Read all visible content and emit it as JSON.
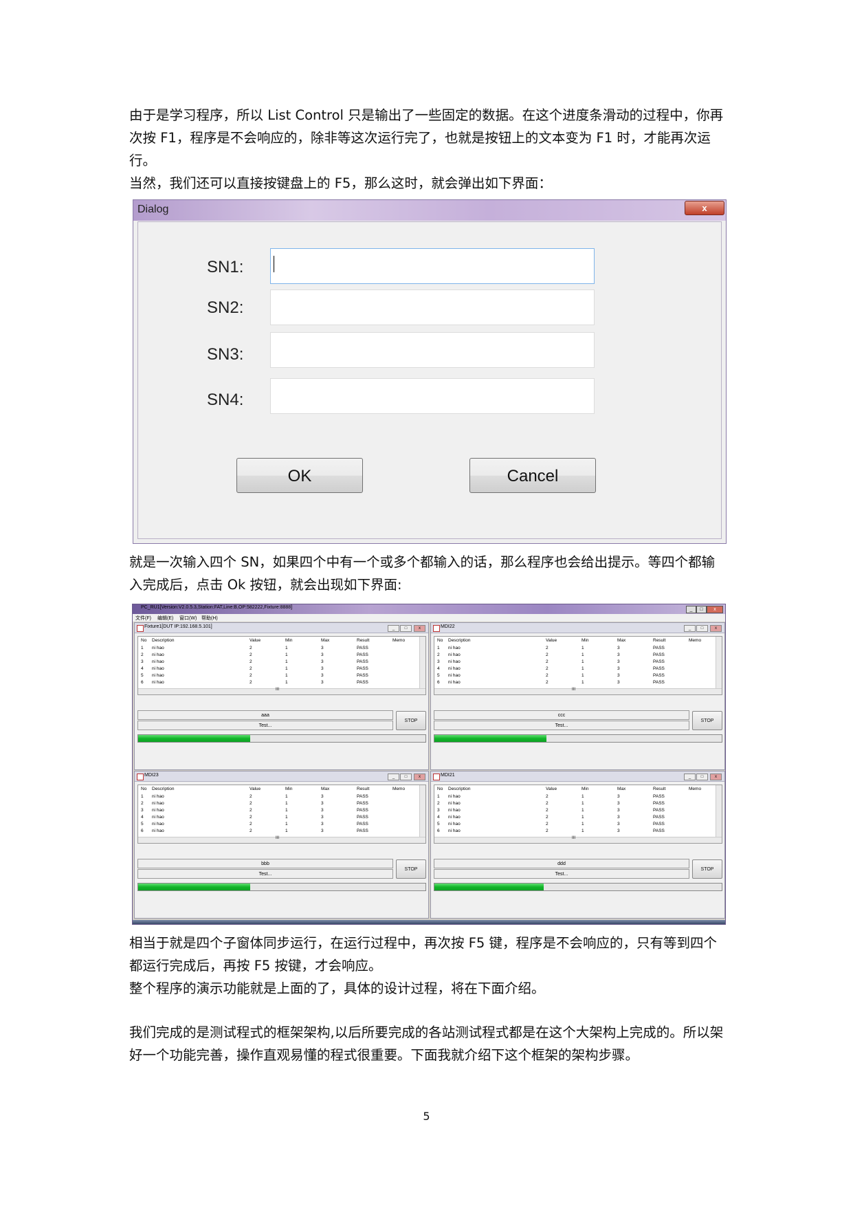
{
  "paragraphs": {
    "p1": "由于是学习程序，所以 List Control 只是输出了一些固定的数据。在这个进度条滑动的过程中，你再次按 F1，程序是不会响应的，除非等这次运行完了，也就是按钮上的文本变为 F1 时，才能再次运行。",
    "p2": "当然，我们还可以直接按键盘上的 F5，那么这时，就会弹出如下界面：",
    "p3": "就是一次输入四个 SN，如果四个中有一个或多个都输入的话，那么程序也会给出提示。等四个都输入完成后，点击 Ok 按钮，就会出现如下界面:",
    "p4": "相当于就是四个子窗体同步运行，在运行过程中，再次按 F5 键，程序是不会响应的，只有等到四个都运行完成后，再按 F5 按键，才会响应。",
    "p5": "整个程序的演示功能就是上面的了，具体的设计过程，将在下面介绍。",
    "p6": "我们完成的是测试程式的框架架构,以后所要完成的各站测试程式都是在这个大架构上完成的。所以架好一个功能完善，操作直观易懂的程式很重要。下面我就介绍下这个框架的架构步骤。"
  },
  "page_number": "5",
  "dialog": {
    "title": "Dialog",
    "close": "x",
    "labels": [
      "SN1:",
      "SN2:",
      "SN3:",
      "SN4:"
    ],
    "ok": "OK",
    "cancel": "Cancel"
  },
  "app": {
    "title": "PC_RU1[Version:V2.0.5.3,Station:FAT,Line:B,OP:582222,Fixture:8888]",
    "menu": [
      "文件(F)",
      "编辑(E)",
      "窗口(W)",
      "帮助(H)"
    ],
    "columns": [
      "No",
      "Description",
      "Value",
      "Min",
      "Max",
      "Result",
      "Memo"
    ],
    "rows": [
      [
        "1",
        "ni hao",
        "2",
        "1",
        "3",
        "PASS",
        ""
      ],
      [
        "2",
        "ni hao",
        "2",
        "1",
        "3",
        "PASS",
        ""
      ],
      [
        "3",
        "ni hao",
        "2",
        "1",
        "3",
        "PASS",
        ""
      ],
      [
        "4",
        "ni hao",
        "2",
        "1",
        "3",
        "PASS",
        ""
      ],
      [
        "5",
        "ni hao",
        "2",
        "1",
        "3",
        "PASS",
        ""
      ],
      [
        "6",
        "ni hao",
        "2",
        "1",
        "3",
        "PASS",
        ""
      ]
    ],
    "scroll_mark": "III",
    "stop_label": "STOP",
    "children": [
      {
        "title": "Fixture1[DUT IP:192.168.5.101]",
        "sn": "aaa",
        "status": "Test...",
        "progress": 0.39
      },
      {
        "title": "MDI22",
        "sn": "ccc",
        "status": "Test...",
        "progress": 0.39
      },
      {
        "title": "MDI23",
        "sn": "bbb",
        "status": "Test...",
        "progress": 0.39
      },
      {
        "title": "MDI21",
        "sn": "ddd",
        "status": "Test...",
        "progress": 0.38
      }
    ]
  }
}
